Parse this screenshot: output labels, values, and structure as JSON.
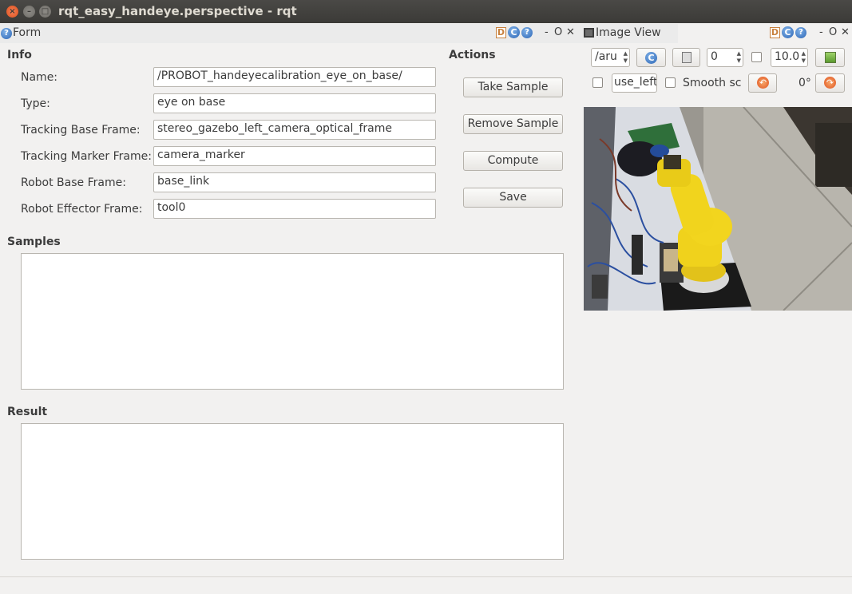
{
  "window": {
    "title": "rqt_easy_handeye.perspective - rqt"
  },
  "form_dock": {
    "title": "Form"
  },
  "image_dock": {
    "title": "Image View"
  },
  "dock_controls": {
    "d": "D",
    "c": "C",
    "help": "?",
    "dash": "-",
    "float": "O",
    "close": "✕"
  },
  "info": {
    "heading": "Info",
    "fields": [
      {
        "label": "Name:",
        "value": "/PROBOT_handeyecalibration_eye_on_base/"
      },
      {
        "label": "Type:",
        "value": "eye on base"
      },
      {
        "label": "Tracking Base Frame:",
        "value": "stereo_gazebo_left_camera_optical_frame"
      },
      {
        "label": "Tracking Marker Frame:",
        "value": "camera_marker"
      },
      {
        "label": "Robot Base Frame:",
        "value": "base_link"
      },
      {
        "label": "Robot Effector Frame:",
        "value": "tool0"
      }
    ]
  },
  "actions": {
    "heading": "Actions",
    "buttons": [
      "Take Sample",
      "Remove Sample",
      "Compute",
      "Save"
    ]
  },
  "samples": {
    "heading": "Samples"
  },
  "result": {
    "heading": "Result"
  },
  "image_view": {
    "topic": "/aru",
    "zoom_value": "0",
    "num_value": "10.0",
    "topic_suffix": "use_left",
    "smooth_label": "Smooth sca",
    "rotation": "0°"
  }
}
